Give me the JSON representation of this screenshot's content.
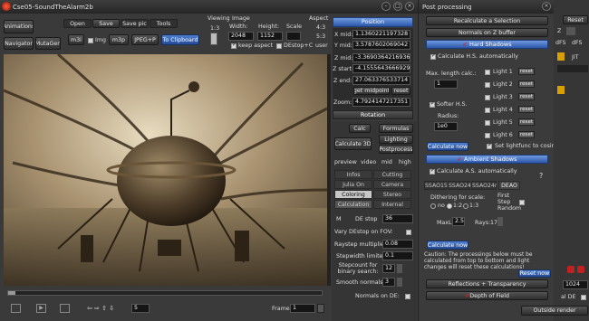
{
  "window": {
    "title": "Cse05-SoundTheAlarm2b"
  },
  "toolbar": {
    "animations": "Animations",
    "navigator": "Navigator",
    "mutagen": "MutaGen",
    "open": "Open",
    "save": "Save",
    "save_pic": "Save pic",
    "tools": "Tools",
    "m3i": "m3i",
    "img": "Img",
    "m3p": "m3p",
    "jpeg_p": "JPEG+P",
    "to_clipboard": "To Clipboard",
    "viewing_label": "Viewing",
    "viewing_value": "1:3",
    "image_label": "Image",
    "width_label": "Width:",
    "height_label": "Height:",
    "scale_label": "Scale",
    "width_value": "2048",
    "height_value": "1152",
    "keep_aspect": "keep aspect",
    "de_stop_c": "DEstop+C",
    "aspect_label": "Aspect",
    "aspect_1": "4:3",
    "aspect_2": "5:3",
    "aspect_3": "user"
  },
  "position": {
    "header": "Position",
    "rows": [
      {
        "label": "X mid:",
        "value": "1.1360221197328"
      },
      {
        "label": "Y mid:",
        "value": "3.5787602069042"
      },
      {
        "label": "Z mid:",
        "value": "-3.3690364216936"
      },
      {
        "label": "Z start:",
        "value": "-4.1555643666929"
      },
      {
        "label": "Z end:",
        "value": "27.063376533714"
      }
    ],
    "get_midpoint": "get midpoint",
    "reset": "reset",
    "zoom_label": "Zoom:",
    "zoom_value": "4.7924147217351",
    "rotation": "Rotation"
  },
  "center_panel": {
    "calc": "Calc",
    "formulas": "Formulas",
    "calculate_3d": "Calculate 3D",
    "lighting": "Lighting",
    "postprocess": "Postprocess",
    "preview": "preview",
    "video": "video",
    "mid": "mid",
    "high": "high",
    "tabs": [
      "Infos",
      "Cutting",
      "Julia On",
      "Camera",
      "Coloring",
      "Stereo"
    ],
    "calculation_tab": "Calculation",
    "internal_tab": "Internal",
    "m_label": "M",
    "de_stop_label": "DE stop",
    "de_stop_value": "36",
    "vary_de_stop": "Vary DEstop on FOV:",
    "raystep_label": "Raystep multiplier:",
    "raystep_value": "0.08",
    "stepwidth_label": "Stepwidth limiter:",
    "stepwidth_value": "0.1",
    "stepcount_label": "Stepcount for binary search:",
    "stepcount_value": "12",
    "smooth_label": "Smooth normals:",
    "smooth_value": "3",
    "normals_on_de": "Normals on DE:",
    "frame_label": "Frame:",
    "frame_value": "1",
    "nav_value": "5"
  },
  "post_processing": {
    "title": "Post processing",
    "recalculate": "Recalculate a Selection",
    "normals_zbuffer": "Normals on Z buffer",
    "hard_shadows": "Hard Shadows",
    "calc_hs_auto": "Calculate H.S. automatically",
    "max_length_label": "Max. length calc.:",
    "max_length_value": "1",
    "lights": [
      "Light 1",
      "Light 2",
      "Light 3",
      "Light 4",
      "Light 5",
      "Light 6"
    ],
    "reset": "reset",
    "softer_hs": "Softer H.S.",
    "radius_label": "Radius:",
    "radius_value": "1e0",
    "calculate_now": "Calculate now",
    "set_lightfunc": "Set lightfunc to cosine",
    "ambient_shadows": "Ambient Shadows",
    "calc_as_auto": "Calculate A.S. automatically",
    "question": "?",
    "ssao_tabs": [
      "SSAO15",
      "SSAO24",
      "SSAO24r",
      "DEAO"
    ],
    "dithering_label": "Dithering for scale:",
    "dither_options": [
      "no",
      "1:2",
      "1:3"
    ],
    "first_step_label": "First Step Random",
    "maxl_label": "MaxL:",
    "maxl_value": "2.5",
    "rays_label": "Rays:",
    "rays_value": "17",
    "caution": "Caution: The processings below must be calculated from top to bottom and light changes will reset these calculations!",
    "reset_now": "Reset now",
    "reflections": "Reflections + Transparency",
    "depth_of_field": "Depth of Field"
  },
  "right_panel": {
    "reset": "Reset",
    "z_label": "Z",
    "dfs1": "dFS",
    "dfs2": "dFS",
    "jit": "JIT",
    "val_1024": "1024",
    "al_de": "al DE",
    "outside_render": "Outside render"
  }
}
